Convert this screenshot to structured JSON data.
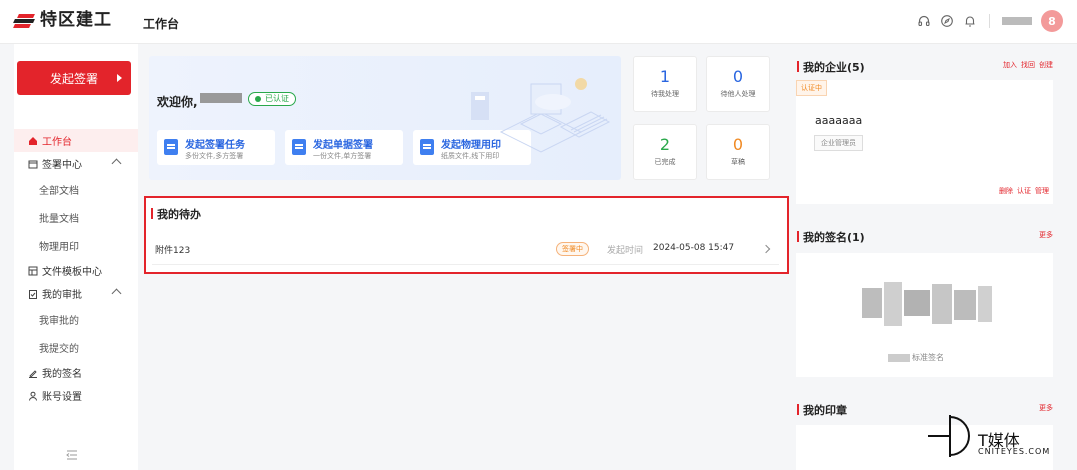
{
  "header": {
    "brand_name": "特区建工",
    "page_title": "工作台",
    "avatar_initial": "8",
    "accent": "#e3242b"
  },
  "sidebar": {
    "start_button": "发起签署",
    "items": [
      {
        "label": "工作台",
        "icon": "home-icon",
        "active": true
      },
      {
        "label": "签署中心",
        "icon": "folder-icon",
        "expanded": true
      },
      {
        "label": "全部文档",
        "sub": true
      },
      {
        "label": "批量文档",
        "sub": true
      },
      {
        "label": "物理用印",
        "sub": true
      },
      {
        "label": "文件模板中心",
        "icon": "template-icon"
      },
      {
        "label": "我的审批",
        "icon": "approval-icon",
        "expanded": true
      },
      {
        "label": "我审批的",
        "sub": true
      },
      {
        "label": "我提交的",
        "sub": true
      },
      {
        "label": "我的签名",
        "icon": "pen-icon"
      },
      {
        "label": "账号设置",
        "icon": "user-icon"
      }
    ]
  },
  "welcome": {
    "greeting": "欢迎你,",
    "verified": "已认证",
    "actions": [
      {
        "title": "发起签署任务",
        "subtitle": "多份文件,多方签署"
      },
      {
        "title": "发起单据签署",
        "subtitle": "一份文件,单方签署"
      },
      {
        "title": "发起物理用印",
        "subtitle": "纸质文件,线下用印"
      }
    ]
  },
  "stats": [
    {
      "value": "1",
      "label": "待我处理",
      "color": "#2a66e0"
    },
    {
      "value": "0",
      "label": "待他人处理",
      "color": "#2a66e0"
    },
    {
      "value": "2",
      "label": "已完成",
      "color": "#29a84a"
    },
    {
      "value": "0",
      "label": "草稿",
      "color": "#f08a24"
    }
  ],
  "pending": {
    "title": "我的待办",
    "item": {
      "name": "附件123",
      "status": "签署中",
      "time_label": "发起时间",
      "time": "2024-05-08 15:47"
    }
  },
  "enterprise": {
    "title": "我的企业(5)",
    "links": [
      "加入",
      "找回",
      "创建"
    ],
    "tag": "认证中",
    "name": "aaaaaaa",
    "role": "企业管理员",
    "actions": [
      "删除",
      "认证",
      "管理"
    ]
  },
  "signature": {
    "title": "我的签名(1)",
    "more": "更多",
    "label": "标准签名"
  },
  "seal": {
    "title": "我的印章",
    "more": "更多"
  },
  "watermark": {
    "name": "T媒体",
    "sub": "CNITEYES.COM"
  }
}
